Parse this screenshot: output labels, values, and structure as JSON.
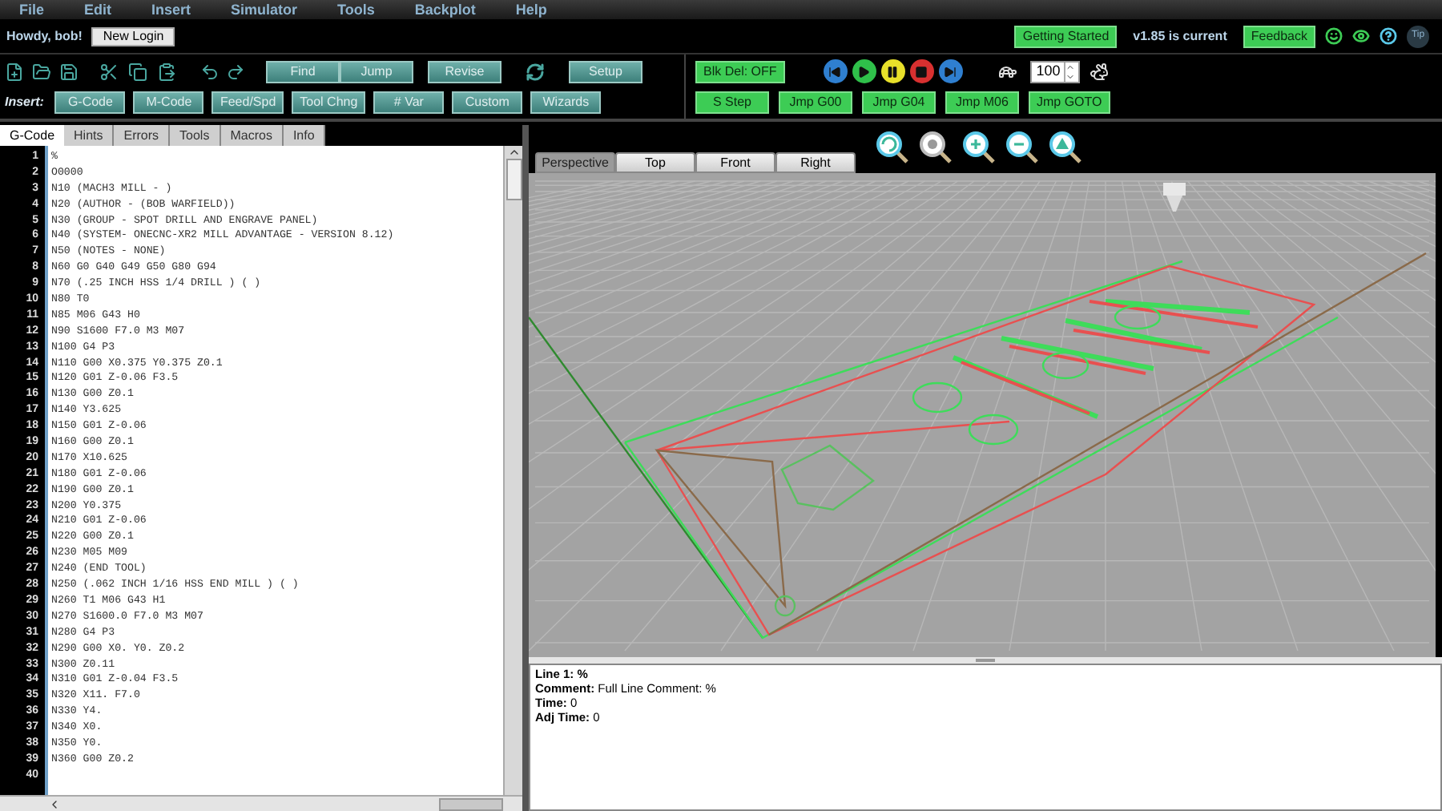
{
  "menu": [
    "File",
    "Edit",
    "Insert",
    "Simulator",
    "Tools",
    "Backplot",
    "Help"
  ],
  "header": {
    "greeting": "Howdy, bob!",
    "login_button": "New Login",
    "getting_started": "Getting Started",
    "version": "v1.85 is current",
    "feedback": "Feedback",
    "tip": "Tip"
  },
  "toolbar": {
    "buttons": [
      "Find",
      "Jump",
      "Revise",
      "Setup"
    ],
    "insert_label": "Insert:",
    "insert_buttons": [
      "G-Code",
      "M-Code",
      "Feed/Spd",
      "Tool Chng",
      "# Var",
      "Custom",
      "Wizards"
    ]
  },
  "simulator": {
    "block_delete": "Blk Del: OFF",
    "speed": "100",
    "buttons": [
      "S Step",
      "Jmp G00",
      "Jmp G04",
      "Jmp M06",
      "Jmp GOTO"
    ]
  },
  "editor_tabs": [
    {
      "label": "G-Code",
      "selected": true
    },
    {
      "label": "Hints",
      "selected": false
    },
    {
      "label": "Errors",
      "selected": false
    },
    {
      "label": "Tools",
      "selected": false
    },
    {
      "label": "Macros",
      "selected": false
    },
    {
      "label": "Info",
      "selected": false
    }
  ],
  "code_lines": [
    {
      "number": "1",
      "text": "%"
    },
    {
      "number": "2",
      "text": "O0000"
    },
    {
      "number": "3",
      "text": "N10 (MACH3 MILL - )"
    },
    {
      "number": "4",
      "text": "N20 (AUTHOR - (BOB WARFIELD))"
    },
    {
      "number": "5",
      "text": "N30 (GROUP - SPOT DRILL AND ENGRAVE PANEL)"
    },
    {
      "number": "6",
      "text": "N40 (SYSTEM- ONECNC-XR2 MILL ADVANTAGE - VERSION 8.12)"
    },
    {
      "number": "7",
      "text": "N50 (NOTES - NONE)"
    },
    {
      "number": "8",
      "text": "N60 G0 G40 G49 G50 G80 G94"
    },
    {
      "number": "9",
      "text": "N70 (.25 INCH HSS 1/4 DRILL ) ( )"
    },
    {
      "number": "10",
      "text": "N80 T0"
    },
    {
      "number": "11",
      "text": "N85 M06 G43 H0"
    },
    {
      "number": "12",
      "text": "N90 S1600 F7.0 M3 M07"
    },
    {
      "number": "13",
      "text": "N100 G4 P3"
    },
    {
      "number": "14",
      "text": "N110 G00 X0.375 Y0.375 Z0.1"
    },
    {
      "number": "15",
      "text": "N120 G01 Z-0.06 F3.5"
    },
    {
      "number": "16",
      "text": "N130 G00 Z0.1"
    },
    {
      "number": "17",
      "text": "N140 Y3.625"
    },
    {
      "number": "18",
      "text": "N150 G01 Z-0.06"
    },
    {
      "number": "19",
      "text": "N160 G00 Z0.1"
    },
    {
      "number": "20",
      "text": "N170 X10.625"
    },
    {
      "number": "21",
      "text": "N180 G01 Z-0.06"
    },
    {
      "number": "22",
      "text": "N190 G00 Z0.1"
    },
    {
      "number": "23",
      "text": "N200 Y0.375"
    },
    {
      "number": "24",
      "text": "N210 G01 Z-0.06"
    },
    {
      "number": "25",
      "text": "N220 G00 Z0.1"
    },
    {
      "number": "26",
      "text": "N230 M05 M09"
    },
    {
      "number": "27",
      "text": "N240 (END TOOL)"
    },
    {
      "number": "28",
      "text": "N250 (.062 INCH 1/16 HSS END MILL ) ( )"
    },
    {
      "number": "29",
      "text": "N260 T1 M06 G43 H1"
    },
    {
      "number": "30",
      "text": "N270 S1600.0 F7.0 M3 M07"
    },
    {
      "number": "31",
      "text": "N280 G4 P3"
    },
    {
      "number": "32",
      "text": "N290 G00 X0. Y0. Z0.2"
    },
    {
      "number": "33",
      "text": "N300 Z0.11"
    },
    {
      "number": "34",
      "text": "N310 G01 Z-0.04 F3.5"
    },
    {
      "number": "35",
      "text": "N320 X11. F7.0"
    },
    {
      "number": "36",
      "text": "N330 Y4."
    },
    {
      "number": "37",
      "text": "N340 X0."
    },
    {
      "number": "38",
      "text": "N350 Y0."
    },
    {
      "number": "39",
      "text": "N360 G00 Z0.2"
    },
    {
      "number": "40"
    }
  ],
  "view_tabs": [
    {
      "label": "Perspective",
      "selected": true
    },
    {
      "label": "Top",
      "selected": false
    },
    {
      "label": "Front",
      "selected": false
    },
    {
      "label": "Right",
      "selected": false
    }
  ],
  "info_panel": {
    "line": "Line 1: %",
    "details": [
      "**Comment:** Full Line Comment: %",
      "**Time:** 0",
      "**Adj Time:** 0"
    ]
  }
}
